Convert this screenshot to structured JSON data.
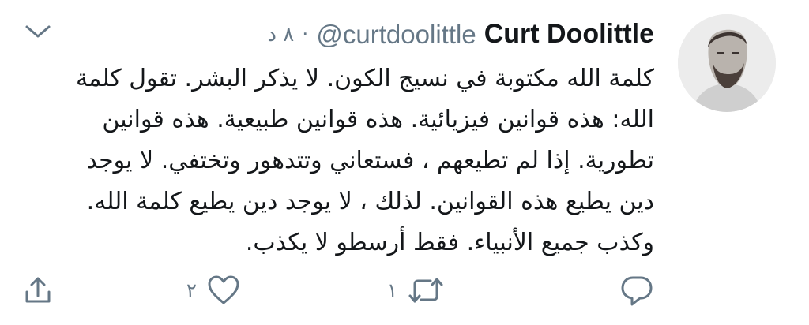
{
  "tweet": {
    "author_name": "Curt Doolittle",
    "author_handle": "@curtdoolittle",
    "separator": "·",
    "timestamp": "٨ د",
    "body_lines": [
      "كلمة الله مكتوبة في نسيج الكون. لا يذكر البشر. تقول كلمة",
      "الله: هذه قوانين فيزيائية. هذه قوانين طبيعية. هذه قوانين",
      "تطورية. إذا لم تطيعهم ، فستعاني وتتدهور وتختفي. لا يوجد",
      "دين يطيع هذه القوانين. لذلك ، لا يوجد دين يطيع كلمة الله.",
      "وكذب جميع الأنبياء. فقط أرسطو لا يكذب."
    ],
    "actions": {
      "retweet_count": "١",
      "like_count": "٢"
    }
  },
  "icons": {
    "caret": "chevron-down-icon",
    "reply": "reply-icon",
    "retweet": "retweet-icon",
    "like": "heart-icon",
    "share": "share-icon"
  },
  "colors": {
    "text": "#14171a",
    "secondary": "#657786"
  }
}
